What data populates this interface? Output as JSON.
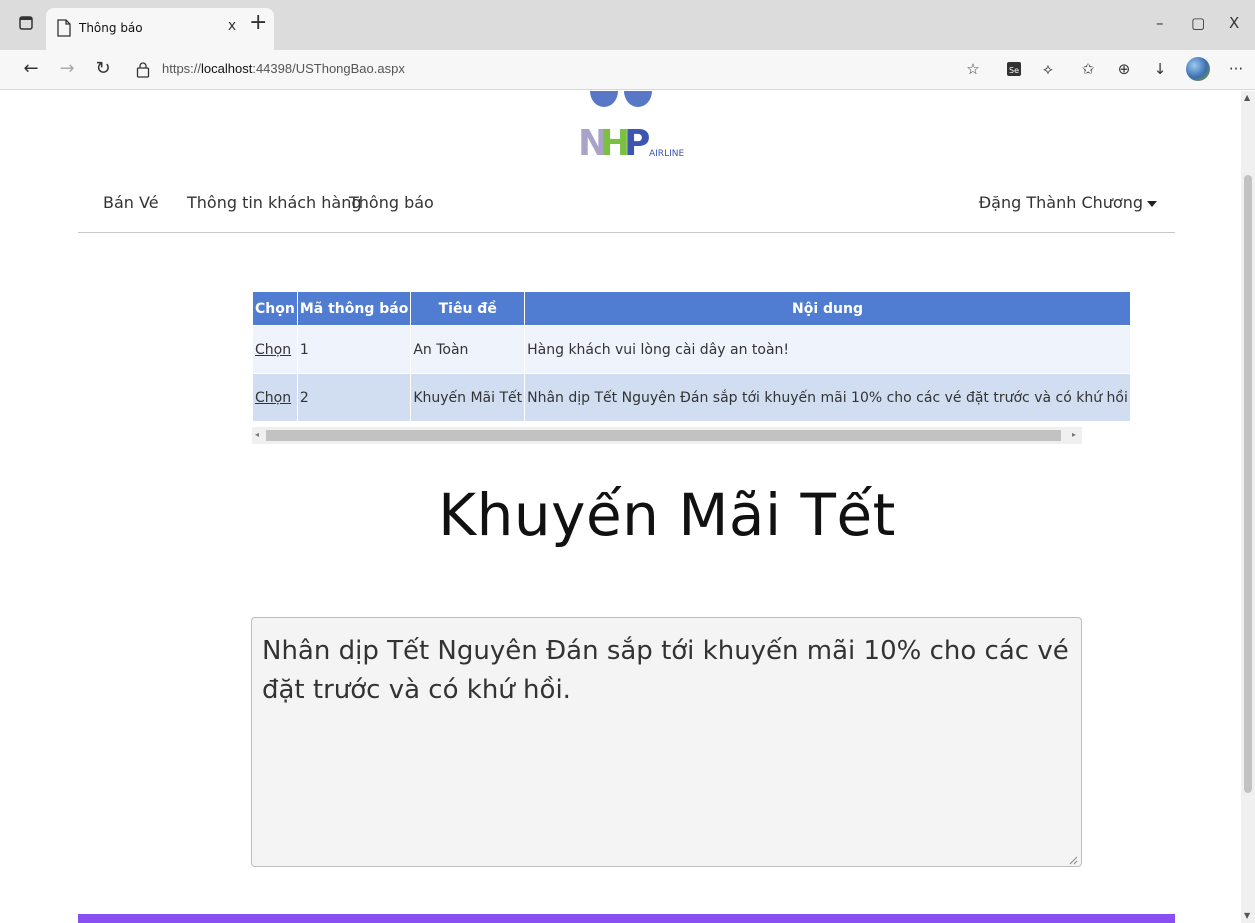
{
  "browser": {
    "tab_title": "Thông báo",
    "tab_close": "x",
    "new_tab": "+",
    "url_prefix": "https://",
    "url_host": "localhost",
    "url_rest": ":44398/USThongBao.aspx",
    "minimize": "–",
    "restore": "▢",
    "close": "X",
    "more": "···"
  },
  "nav": {
    "items": [
      "Bán Vé",
      "Thông tin khách hàng",
      "Thông báo"
    ],
    "user": "Đặng Thành Chương"
  },
  "logo": {
    "brand": "NHP",
    "sub": "AIRLINE"
  },
  "grid": {
    "headers": [
      "Chọn",
      "Mã thông báo",
      "Tiêu đề",
      "Nội dung"
    ],
    "header_color": "#507CD1",
    "rows": [
      {
        "select": "Chọn",
        "id": "1",
        "title": "An Toàn",
        "content": "Hàng khách vui lòng cài dây an toàn!"
      },
      {
        "select": "Chọn",
        "id": "2",
        "title": "Khuyến Mãi Tết",
        "content": "Nhân dịp Tết Nguyên Đán sắp tới khuyến mãi 10% cho các vé đặt trước và có khứ hồi"
      }
    ]
  },
  "detail": {
    "title": "Khuyến Mãi Tết",
    "content": "Nhân dịp Tết Nguyên Đán sắp tới khuyến mãi 10% cho các vé đặt trước và có khứ hồi."
  },
  "footer_color": "#8a4ff0"
}
